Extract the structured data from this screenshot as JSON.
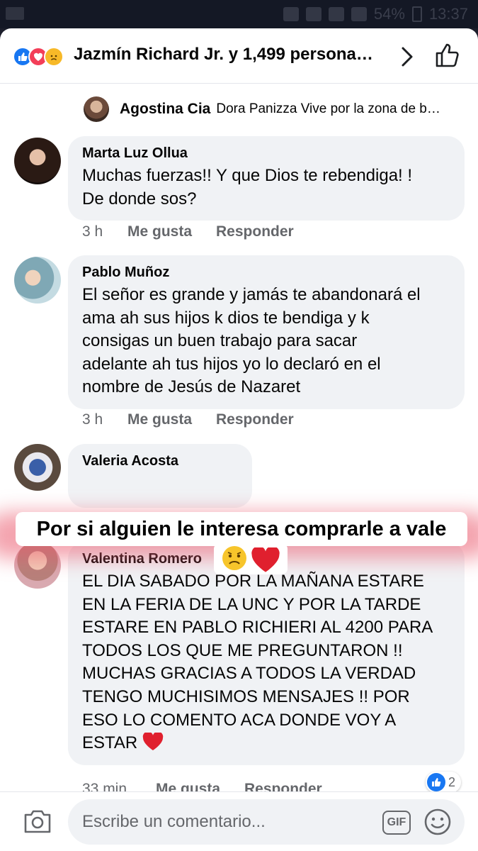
{
  "status_bar": {
    "battery": "54%",
    "time": "13:37"
  },
  "header": {
    "title": "Jazmín Richard Jr. y 1,499 persona…",
    "reactions": [
      "like-icon",
      "love-icon",
      "sad-icon"
    ]
  },
  "reply_preview": {
    "name": "Agostina Cia",
    "text": "Dora Panizza Vive por la zona de b…"
  },
  "comments": [
    {
      "name": "Marta Luz Ollua",
      "text": "Muchas fuerzas!! Y que Dios te rebendiga! !\nDe donde sos?",
      "time": "3 h",
      "like_label": "Me gusta",
      "reply_label": "Responder"
    },
    {
      "name": "Pablo Muñoz",
      "text": "El señor es grande y jamás te abandonará el\nama ah sus hijos k dios te bendiga y k\nconsigas un buen trabajo para sacar\nadelante ah tus hijos yo lo declaró en el\nnombre de Jesús de Nazaret",
      "time": "3 h",
      "like_label": "Me gusta",
      "reply_label": "Responder"
    },
    {
      "name": "Valeria Acosta",
      "text": "",
      "time": "",
      "like_label": "",
      "reply_label": ""
    },
    {
      "name": "Valentina Romero",
      "text": "EL DIA SABADO POR LA MAÑANA ESTARE\nEN LA FERIA DE LA UNC  Y POR LA TARDE\nESTARE EN PABLO RICHIERI AL 4200 PARA\nTODOS LOS QUE ME PREGUNTARON !!\nMUCHAS  GRACIAS A TODOS LA VERDAD\nTENGO MUCHISIMOS MENSAJES !! POR\nESO LO COMENTO ACA DONDE VOY A\nESTAR",
      "time": "33 min",
      "like_label": "Me gusta",
      "reply_label": "Responder",
      "like_count": "2"
    }
  ],
  "overlay": {
    "caption": "Por si alguien le interesa comprarle a vale"
  },
  "footer": {
    "placeholder": "Escribe un comentario...",
    "gif_label": "GIF"
  },
  "colors": {
    "facebook_blue": "#1877f2",
    "love_red": "#f33e58",
    "bubble_gray": "#f0f2f5",
    "meta_gray": "#65676b"
  }
}
